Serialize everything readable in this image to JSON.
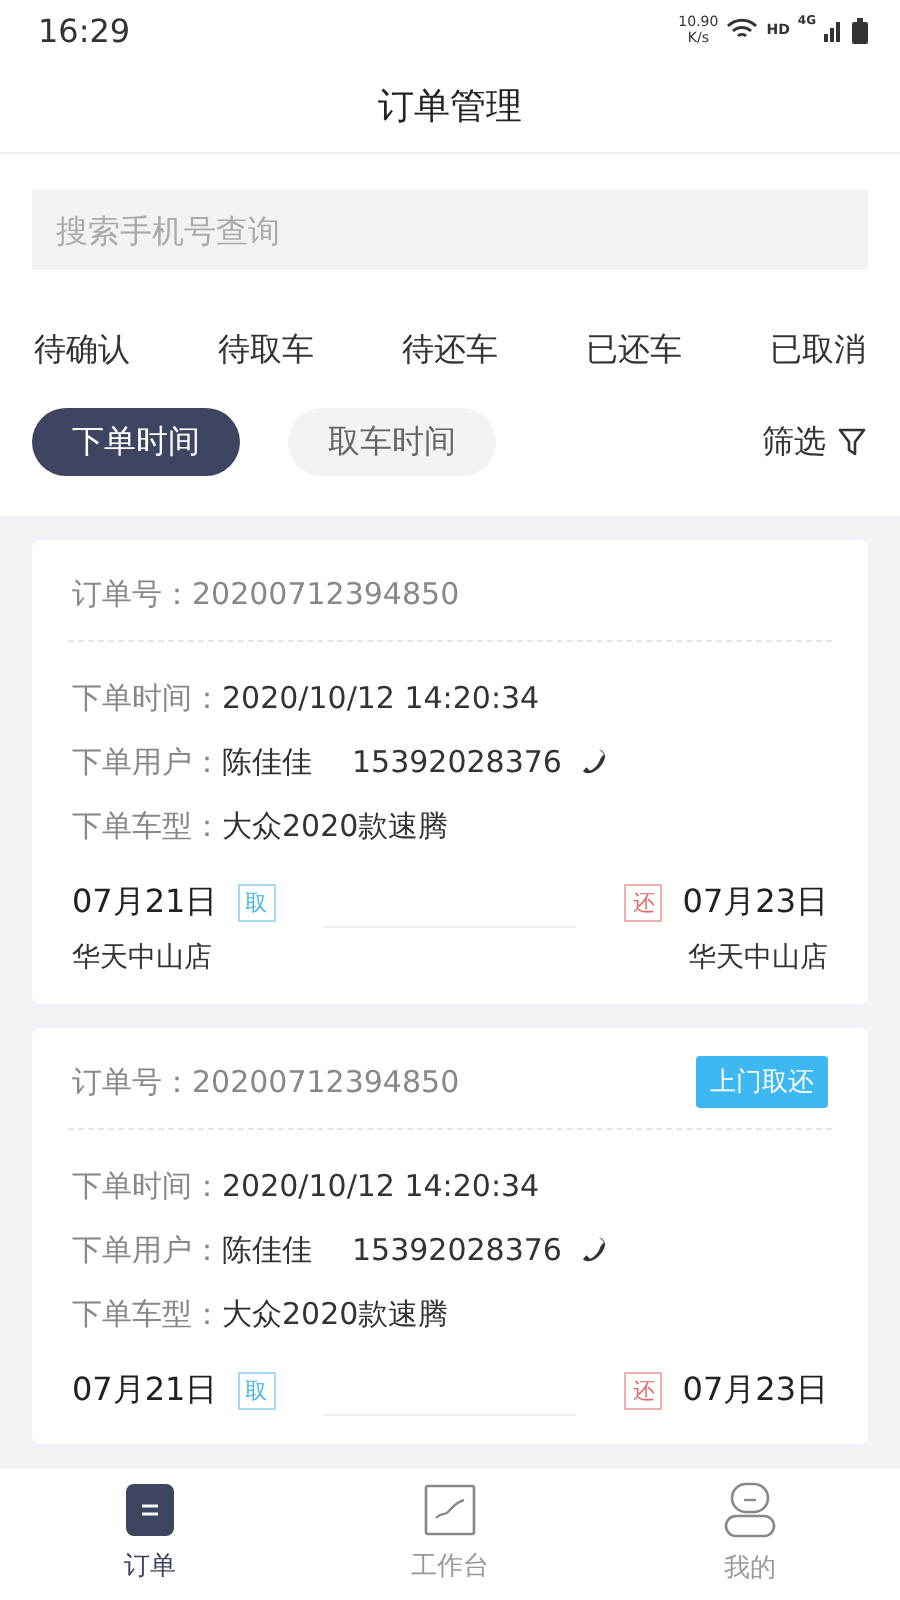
{
  "status_bar": {
    "time": "16:29",
    "speed": "10.90",
    "speed_unit": "K/s",
    "hd": "HD",
    "network": "4G"
  },
  "title": "订单管理",
  "search": {
    "placeholder": "搜索手机号查询"
  },
  "tabs": [
    {
      "label": "待确认",
      "selected": false
    },
    {
      "label": "待取车",
      "selected": false
    },
    {
      "label": "待还车",
      "selected": false
    },
    {
      "label": "已还车",
      "selected": false
    },
    {
      "label": "已取消",
      "selected": false
    }
  ],
  "sort": [
    {
      "label": "下单时间",
      "selected": true
    },
    {
      "label": "取车时间",
      "selected": false
    }
  ],
  "filter": "筛选",
  "orders": [
    {
      "number_label": "订单号：",
      "number": "20200712394850",
      "time_label": "下单时间：",
      "time": "2020/10/12  14:20:34",
      "user_label": "下单用户：",
      "user": "陈佳佳",
      "phone": "15392028376",
      "car_label": "下单车型：",
      "car": "大众2020款速腾",
      "pickup_date": "07月21日",
      "pickup_tag": "取",
      "return_tag": "还",
      "return_date": "07月23日",
      "pickup_store": "华天中山店",
      "return_store": "华天中山店"
    },
    {
      "number_label": "订单号：",
      "number": "20200712394850",
      "badge": "上门取还",
      "time_label": "下单时间：",
      "time": "2020/10/12  14:20:34",
      "user_label": "下单用户：",
      "user": "陈佳佳",
      "phone": "15392028376",
      "car_label": "下单车型：",
      "car": "大众2020款速腾",
      "pickup_date": "07月21日",
      "pickup_tag": "取",
      "return_tag": "还",
      "return_date": "07月23日"
    }
  ],
  "nav": [
    {
      "label": "订单",
      "kind": "orders",
      "selected": true
    },
    {
      "label": "工作台",
      "kind": "workbench",
      "selected": false
    },
    {
      "label": "我的",
      "kind": "profile",
      "selected": false
    }
  ]
}
